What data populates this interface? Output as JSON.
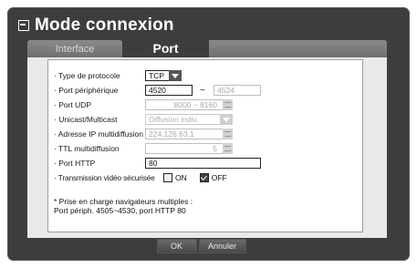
{
  "title": "Mode connexion",
  "icons": {
    "title": "window-icon"
  },
  "tabs": [
    {
      "label": "Interface",
      "active": false
    },
    {
      "label": "Port",
      "active": true
    }
  ],
  "fields": {
    "protocol_type": {
      "label": "· Type de protocole",
      "value": "TCP"
    },
    "device_port": {
      "label": "· Port périphérique",
      "value": "4520",
      "separator": "~",
      "end_value": "4524"
    },
    "udp_port": {
      "label": "· Port UDP",
      "value": "8000 ~ 8160"
    },
    "unicast_multicast": {
      "label": "· Unicast/Multicast",
      "value": "Diffusion indiv."
    },
    "multicast_ip": {
      "label": "· Adresse IP multidiffusion",
      "value": "224.126.63.1"
    },
    "multicast_ttl": {
      "label": "· TTL multidiffusion",
      "value": "5"
    },
    "http_port": {
      "label": "· Port HTTP",
      "value": "80"
    },
    "secure_video": {
      "label": "· Transmission vidéo sécurisée",
      "on_label": "ON",
      "off_label": "OFF",
      "on_checked": false,
      "off_checked": true
    }
  },
  "note": {
    "line1": "* Prise en charge navigateurs multiples :",
    "line2": "Port périph. 4505~4530, port HTTP 80"
  },
  "buttons": {
    "ok": "OK",
    "cancel": "Annuler"
  }
}
